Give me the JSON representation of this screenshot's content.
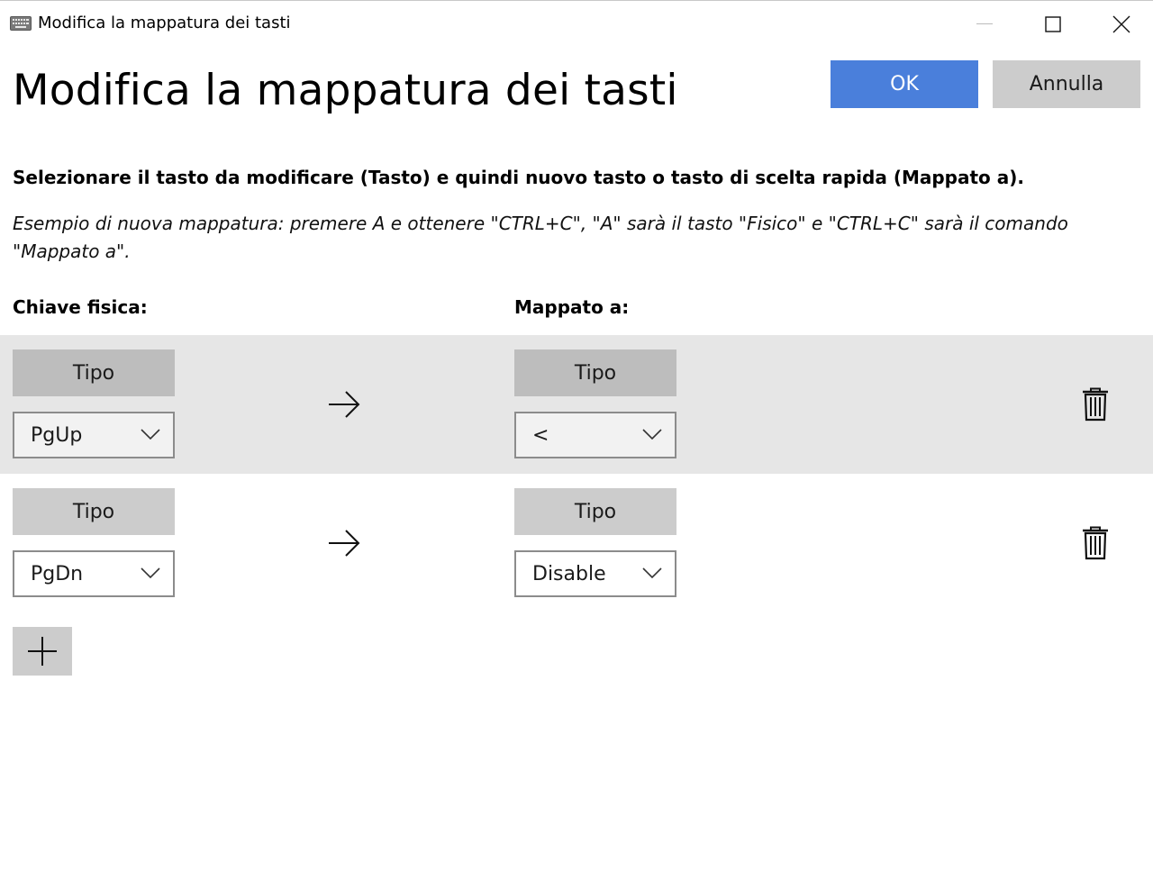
{
  "window": {
    "title": "Modifica la mappatura dei tasti",
    "app_icon": "keyboard-icon",
    "controls": [
      "minimize-icon",
      "maximize-icon",
      "close-icon"
    ]
  },
  "header": {
    "title": "Modifica la mappatura dei tasti",
    "ok_label": "OK",
    "cancel_label": "Annulla"
  },
  "instructions": {
    "main": "Selezionare il tasto da modificare (Tasto) e quindi nuovo tasto o tasto di scelta rapida (Mappato a).",
    "example": "Esempio di nuova mappatura: premere A e ottenere \"CTRL+C\", \"A\" sarà il tasto \"Fisico\" e \"CTRL+C\" sarà il comando \"Mappato a\"."
  },
  "columns": {
    "physical": "Chiave fisica:",
    "mapped": "Mappato a:"
  },
  "mappings": [
    {
      "physical_type_label": "Tipo",
      "physical_key": "PgUp",
      "mapped_type_label": "Tipo",
      "mapped_key": "<",
      "highlighted": true
    },
    {
      "physical_type_label": "Tipo",
      "physical_key": "PgDn",
      "mapped_type_label": "Tipo",
      "mapped_key": "Disable",
      "highlighted": false
    }
  ],
  "icons": {
    "arrow": "arrow-right-icon",
    "delete": "trash-icon",
    "add": "plus-icon",
    "dropdown": "chevron-down-icon"
  },
  "colors": {
    "accent": "#4a7fdb",
    "button_gray": "#cccccc",
    "row_highlight": "#e6e6e6"
  }
}
